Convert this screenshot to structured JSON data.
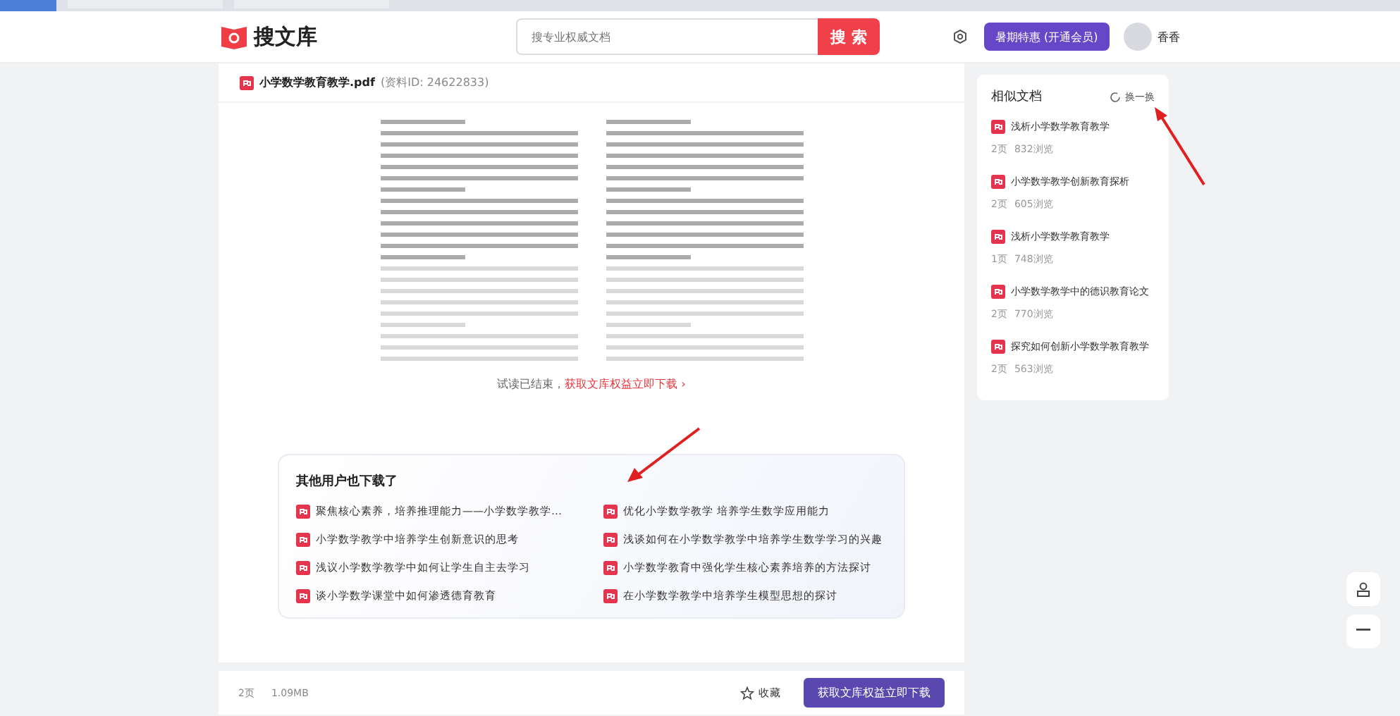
{
  "header": {
    "logo": "搜文库",
    "search": {
      "placeholder": "搜专业权威文档",
      "button": "搜 索"
    },
    "promo_button": "暑期特惠 (开通会员)",
    "user": {
      "name": "香香"
    }
  },
  "document": {
    "file_name": "小学数学教育教学.pdf",
    "doc_id": "(资料ID: 24622833)",
    "preview_end": "试读已结束，",
    "download_link": "获取文库权益立即下载 ›"
  },
  "also_downloaded": {
    "title": "其他用户也下载了",
    "items": [
      "聚焦核心素养，培养推理能力——小学数学教学…",
      "优化小学数学教学 培养学生数学应用能力",
      "小学数学教学中培养学生创新意识的思考",
      "浅谈如何在小学数学教学中培养学生数学学习的兴趣",
      "浅议小学数学教学中如何让学生自主去学习",
      "小学数学教育中强化学生核心素养培养的方法探讨",
      "谈小学数学课堂中如何渗透德育教育",
      "在小学数学教学中培养学生模型思想的探讨"
    ]
  },
  "footer": {
    "pages": "2页",
    "size": "1.09MB",
    "favorite": "收藏",
    "download_button": "获取文库权益立即下载"
  },
  "similar": {
    "title": "相似文档",
    "refresh": "换一换",
    "items": [
      {
        "title": "浅析小学数学教育教学",
        "pages": "2页",
        "views": "832浏览"
      },
      {
        "title": "小学数学教学创新教育探析",
        "pages": "2页",
        "views": "605浏览"
      },
      {
        "title": "浅析小学数学教育教学",
        "pages": "1页",
        "views": "748浏览"
      },
      {
        "title": "小学数学教学中的德识教育论文",
        "pages": "2页",
        "views": "770浏览"
      },
      {
        "title": "探究如何创新小学数学教育教学",
        "pages": "2页",
        "views": "563浏览"
      }
    ]
  }
}
